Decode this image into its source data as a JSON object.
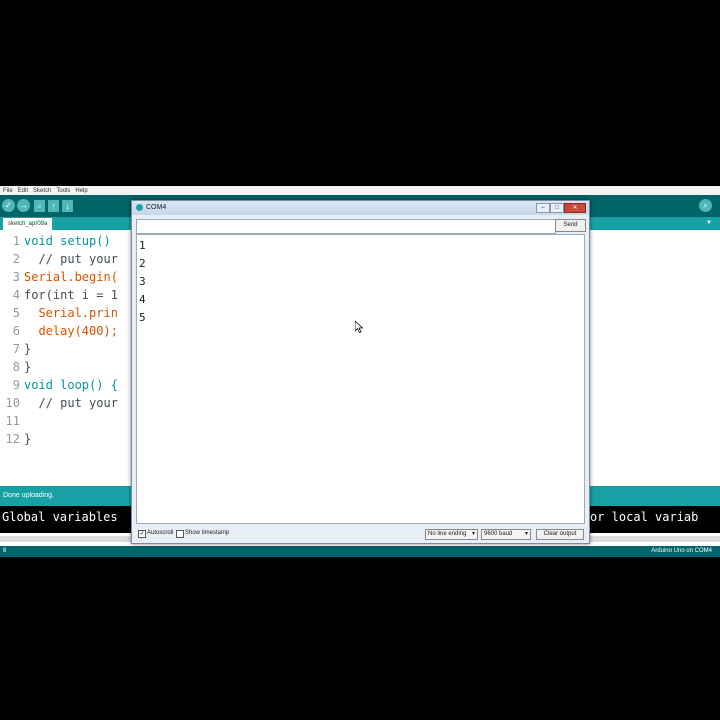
{
  "ide": {
    "menu": [
      "File",
      "Edit",
      "Sketch",
      "Tools",
      "Help"
    ],
    "tab_name": "sketch_apr09a",
    "code_lines": [
      {
        "num": "1",
        "text": "void setup()"
      },
      {
        "num": "2",
        "text": "  // put your"
      },
      {
        "num": "3",
        "text": "Serial.begin("
      },
      {
        "num": "4",
        "text": "for(int i = 1"
      },
      {
        "num": "5",
        "text": "  Serial.prin"
      },
      {
        "num": "6",
        "text": "  delay(400);"
      },
      {
        "num": "7",
        "text": "}"
      },
      {
        "num": "8",
        "text": "}"
      },
      {
        "num": "9",
        "text": "void loop() {"
      },
      {
        "num": "10",
        "text": "  // put your"
      },
      {
        "num": "11",
        "text": ""
      },
      {
        "num": "12",
        "text": "}"
      }
    ],
    "status": "Done uploading.",
    "console_left": "Global variables",
    "console_right": "or local variab",
    "line_number": "8",
    "board_info": "Arduino Uno on COM4"
  },
  "serial_monitor": {
    "title": "COM4",
    "send_label": "Send",
    "input_value": "",
    "output_lines": [
      "1",
      "2",
      "3",
      "4",
      "5"
    ],
    "autoscroll_label": "Autoscroll",
    "autoscroll_checked": true,
    "timestamp_label": "Show timestamp",
    "line_ending": "No line ending",
    "baud_rate": "9600 baud",
    "clear_label": "Clear output"
  },
  "colors": {
    "arduino_teal_dark": "#006468",
    "arduino_teal": "#17a1a5",
    "keyword": "#00979c",
    "function": "#d35400"
  }
}
